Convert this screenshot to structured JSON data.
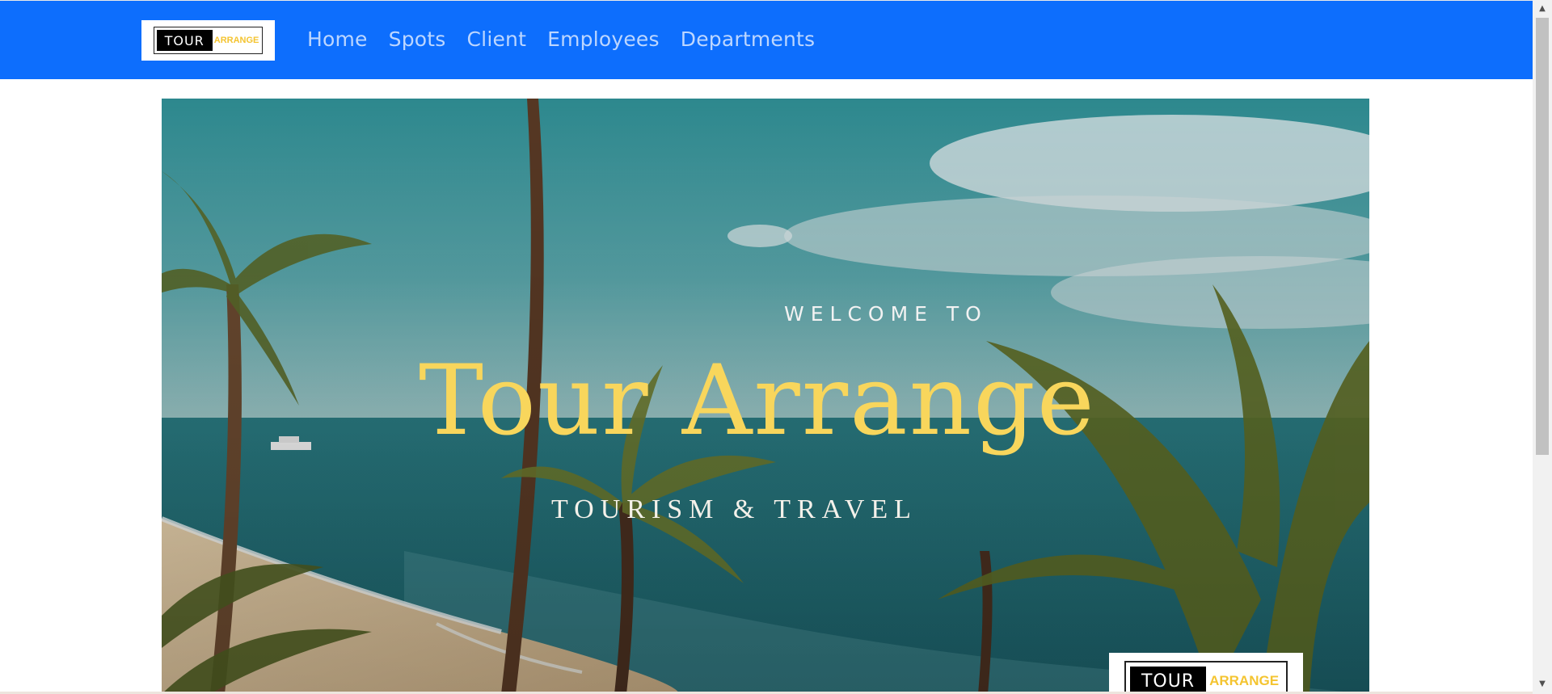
{
  "nav": {
    "logo": {
      "tour": "TOUR",
      "arrange": "ARRANGE"
    },
    "links": [
      "Home",
      "Spots",
      "Client",
      "Employees",
      "Departments"
    ]
  },
  "hero": {
    "welcome": "WELCOME TO",
    "title": "Tour Arrange",
    "subtitle": "TOURISM & TRAVEL",
    "logo": {
      "tour": "TOUR",
      "arrange": "ARRANGE"
    }
  },
  "scrollbar": {
    "up_icon": "arrow-up-icon",
    "down_icon": "arrow-down-icon"
  },
  "colors": {
    "navbar": "#0d6efd",
    "nav_link": "#bcd6ff",
    "title_gold": "#f8d65c",
    "logo_arrange": "#f4c430"
  }
}
